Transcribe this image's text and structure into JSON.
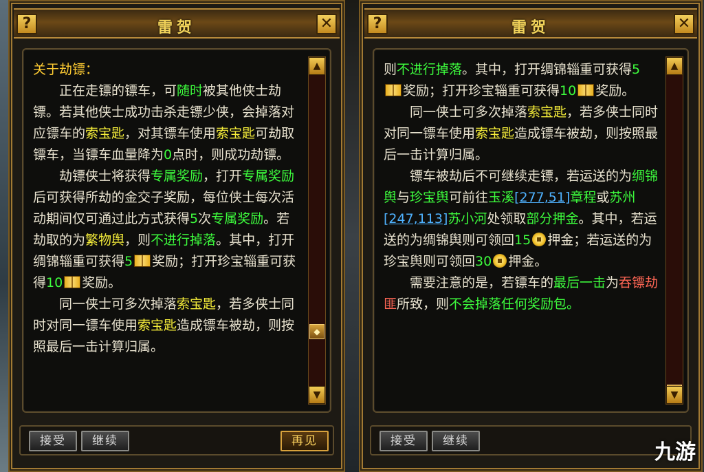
{
  "left": {
    "title": "雷贺",
    "help_label": "?",
    "close_label": "✕",
    "buttons": {
      "accept": "接受",
      "continue": "继续",
      "goodbye": "再见"
    },
    "content": {
      "heading": "关于劫镖：",
      "p1": [
        "正在走镖的镖车，可",
        "随时",
        "被其他侠士劫镖。若其他侠士成功击杀走镖少侠，会掉落对应镖车的",
        "索宝匙",
        "，对其镖车使用",
        "索宝匙",
        "可劫取镖车，当镖车血量降为",
        "0",
        "点时，则成功劫镖。"
      ],
      "p2": [
        "劫镖侠士将获得",
        "专属奖励",
        "，打开",
        "专属奖励",
        "后可获得所劫的金交子奖励，每位侠士每次活动期间仅可通过此方式获得",
        "5",
        "次",
        "专属奖励",
        "。若劫取的为",
        "繁物舆",
        "，则",
        "不进行掉落",
        "。其中，打开绸锦辎重可获得",
        "5",
        "奖励；打开珍宝辎重可获得",
        "10",
        "奖励。"
      ],
      "p3": [
        "同一侠士可多次掉落",
        "索宝匙",
        "，若多侠士同时对同一镖车使用",
        "索宝匙",
        "造成镖车被劫，则按照最后一击计算归属。"
      ]
    }
  },
  "right": {
    "title": "雷贺",
    "help_label": "?",
    "close_label": "✕",
    "buttons": {
      "accept": "接受",
      "continue": "继续"
    },
    "content": {
      "p0": [
        "则",
        "不进行掉落",
        "。其中，打开绸锦辎重可获得",
        "5",
        "奖励；打开珍宝辎重可获得",
        "10",
        "奖励。"
      ],
      "p1": [
        "同一侠士可多次掉落",
        "索宝匙",
        "，若多侠士同时对同一镖车使用",
        "索宝匙",
        "造成镖车被劫，则按照最后一击计算归属。"
      ],
      "p2": [
        "镖车被劫后不可继续走镖，若运送的为",
        "绸锦舆",
        "与",
        "珍宝舆",
        "可前往",
        "玉溪",
        "[277,51]",
        "章程",
        "或",
        "苏州",
        "[247,113]",
        "苏小河",
        "处领取",
        "部分押金",
        "。其中，若运送的为绸锦舆则可领回",
        "15",
        "押金；若运送的为珍宝舆则可领回",
        "30",
        "押金。"
      ],
      "p3": [
        "需要注意的是，若镖车的",
        "最后一击",
        "为",
        "吞镖劫匪",
        "所致，则",
        "不会掉落任何奖励",
        "包。"
      ]
    },
    "watermark": "九游"
  }
}
